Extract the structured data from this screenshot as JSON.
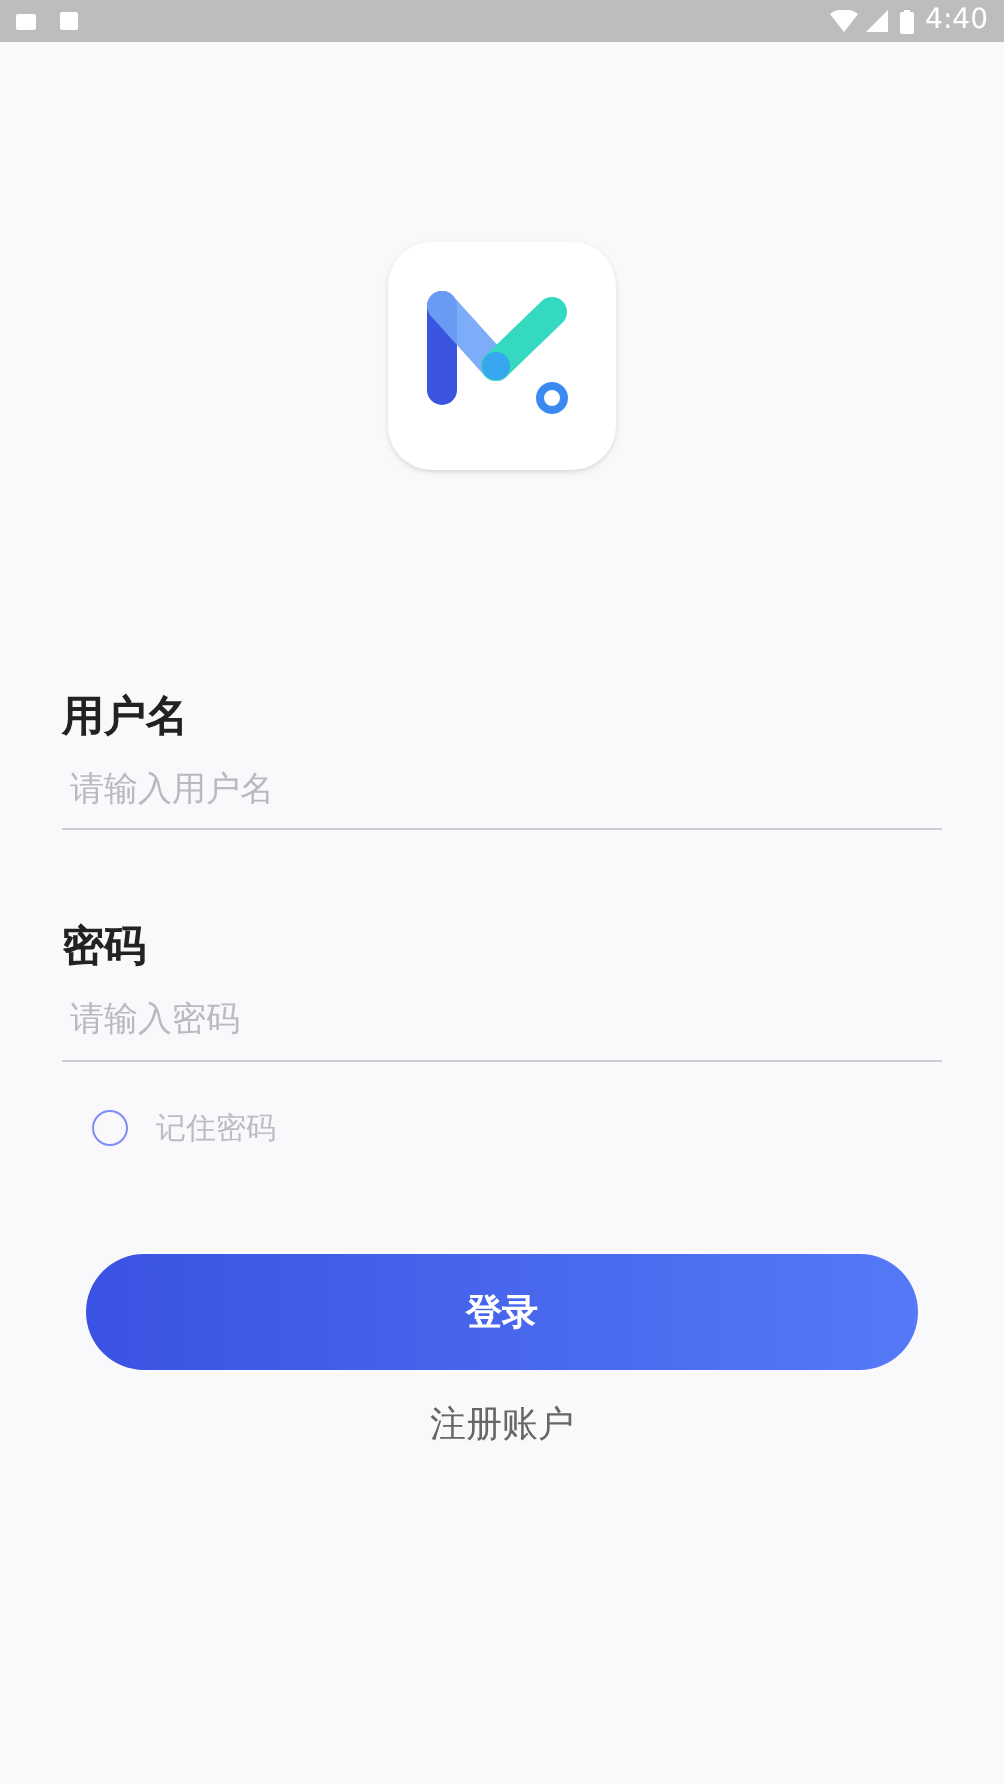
{
  "status_bar": {
    "time": "4:40"
  },
  "fields": [
    {
      "label": "用户名",
      "placeholder": "请输入用户名"
    },
    {
      "label": "密码",
      "placeholder": "请输入密码"
    }
  ],
  "remember": {
    "label": "记住密码",
    "checked": false
  },
  "login_button": "登录",
  "register_link": "注册账户"
}
